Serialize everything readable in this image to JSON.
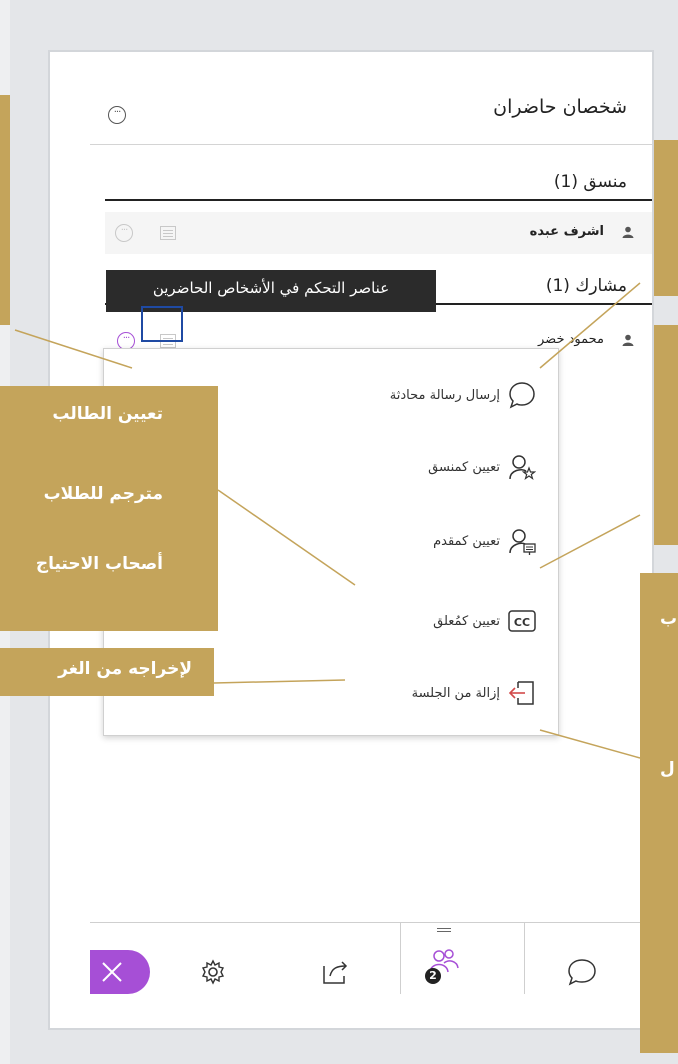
{
  "panel": {
    "title": "شخصان حاضران",
    "sections": [
      {
        "label": "منسق (1)",
        "people": [
          {
            "name": "اشرف عبده"
          }
        ]
      },
      {
        "label": "مشارك (1)",
        "people": [
          {
            "name": "محمود خضر"
          }
        ]
      }
    ]
  },
  "tooltip": "عناصر التحكم في الأشخاص الحاضرين",
  "menu": {
    "items": [
      {
        "label": "إرسال رسالة محادثة",
        "icon": "chat-bubble-icon"
      },
      {
        "label": "تعيين كمنسق",
        "icon": "person-star-icon"
      },
      {
        "label": "تعيين كمقدم",
        "icon": "person-presenter-icon"
      },
      {
        "label": "تعيين كمُعلق",
        "icon": "closed-caption-icon"
      },
      {
        "label": "إزالة من الجلسة",
        "icon": "exit-icon"
      }
    ]
  },
  "callouts": {
    "left_block": [
      "تعيين الطالب",
      "مترجم للطلاب",
      "أصحاب الاحتياج"
    ],
    "left_remove": "لإخراجه من الغر",
    "right_partial_1": "ب",
    "right_partial_2": "ل"
  },
  "tabs": [
    {
      "name": "close",
      "icon": "close-icon"
    },
    {
      "name": "settings",
      "icon": "gear-icon"
    },
    {
      "name": "share",
      "icon": "share-icon"
    },
    {
      "name": "attendees",
      "icon": "people-icon",
      "badge": "2"
    },
    {
      "name": "chat",
      "icon": "chat-bubble-icon"
    }
  ],
  "colors": {
    "gold": "#c4a45b",
    "accent": "#a64fd6",
    "highlight_border": "#1f4aa3"
  }
}
